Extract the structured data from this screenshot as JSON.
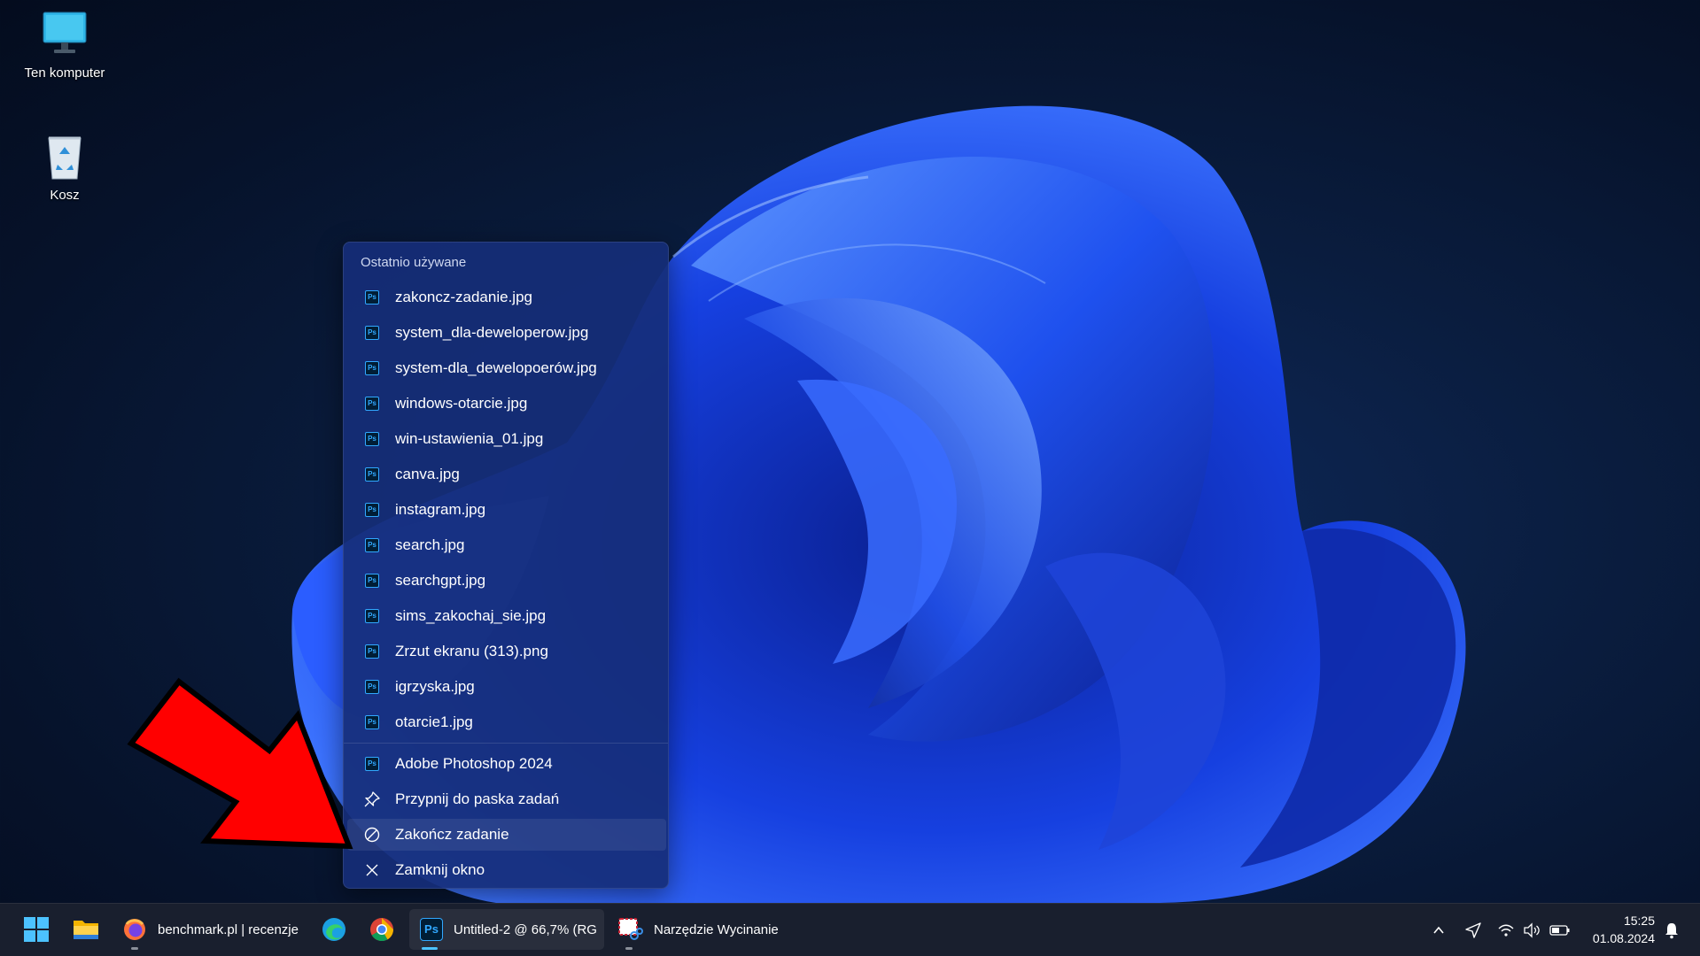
{
  "desktop": {
    "icons": [
      {
        "label": "Ten komputer",
        "icon": "monitor-icon"
      },
      {
        "label": "Kosz",
        "icon": "recycle-bin-icon"
      }
    ]
  },
  "jumplist": {
    "header": "Ostatnio używane",
    "recent": [
      "zakoncz-zadanie.jpg",
      "system_dla-deweloperow.jpg",
      "system-dla_dewelopoerów.jpg",
      "windows-otarcie.jpg",
      "win-ustawienia_01.jpg",
      "canva.jpg",
      "instagram.jpg",
      "search.jpg",
      "searchgpt.jpg",
      "sims_zakochaj_sie.jpg",
      "Zrzut ekranu (313).png",
      "igrzyska.jpg",
      "otarcie1.jpg"
    ],
    "app_name": "Adobe Photoshop 2024",
    "pin": "Przypnij do paska zadań",
    "end_task": "Zakończ zadanie",
    "close_window": "Zamknij okno",
    "ps_badge": "Ps"
  },
  "taskbar": {
    "firefox_title": "benchmark.pl | recenzje",
    "photoshop_title": "Untitled-2 @ 66,7% (RG",
    "snipping_title": "Narzędzie Wycinanie",
    "ps_badge": "Ps",
    "time": "15:25",
    "date": "01.08.2024"
  },
  "colors": {
    "accent": "#4cc2ff",
    "jumplist_bg": "#162e78",
    "arrow": "#ff0000",
    "photoshop": "#31a8ff"
  }
}
